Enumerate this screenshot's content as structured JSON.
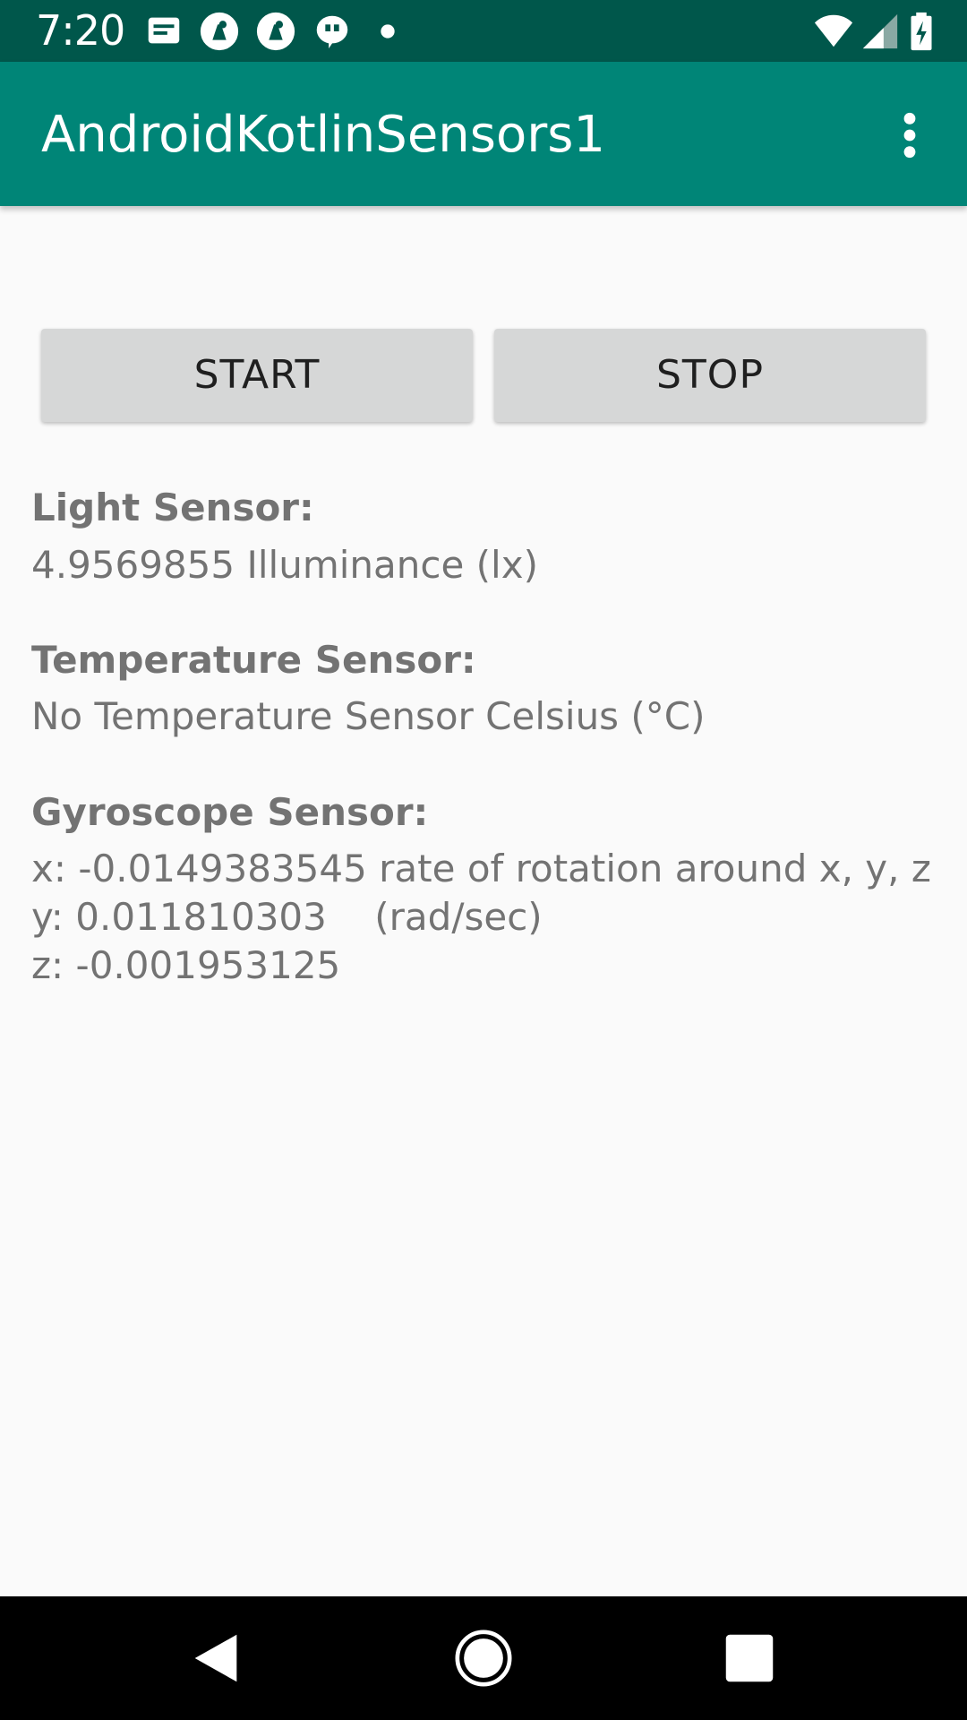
{
  "status_bar": {
    "time": "7:20",
    "icons": [
      "message-icon",
      "android-debug-icon",
      "android-debug-icon",
      "quote-icon",
      "dot-icon",
      "wifi-icon",
      "signal-icon",
      "battery-charging-icon"
    ]
  },
  "app_bar": {
    "title": "AndroidKotlinSensors1",
    "menu_icon": "more-vert-icon"
  },
  "buttons": {
    "start_label": "START",
    "stop_label": "STOP"
  },
  "sensors": {
    "light": {
      "label": "Light Sensor:",
      "value": "4.9569855 Illuminance (lx)"
    },
    "temperature": {
      "label": "Temperature Sensor:",
      "value": "No Temperature Sensor Celsius (°C)"
    },
    "gyroscope": {
      "label": "Gyroscope Sensor:",
      "x_line": "x: -0.0149383545 rate of rotation around x, y, z",
      "y_line": "y: 0.011810303    (rad/sec)",
      "z_line": "z: -0.001953125"
    }
  },
  "nav_bar": {
    "buttons": [
      "back-icon",
      "home-icon",
      "recents-icon"
    ]
  },
  "colors": {
    "status_bar": "#00574b",
    "app_bar": "#008577",
    "background": "#fafafa",
    "button": "#d6d7d7",
    "text_secondary": "#737373"
  }
}
